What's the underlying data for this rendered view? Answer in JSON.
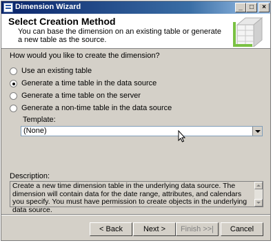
{
  "window": {
    "title": "Dimension Wizard",
    "controls": {
      "minimize": "_",
      "maximize": "□",
      "close": "×"
    }
  },
  "header": {
    "title": "Select Creation Method",
    "description": "You can base the dimension on an existing table or generate a new table as the source."
  },
  "question": "How would you like to create the dimension?",
  "options": [
    {
      "label": "Use an existing table",
      "checked": false
    },
    {
      "label": "Generate a time table in the data source",
      "checked": true
    },
    {
      "label": "Generate a time table on the server",
      "checked": false
    },
    {
      "label": "Generate a non-time table in the data source",
      "checked": false
    }
  ],
  "template": {
    "label": "Template:",
    "value": "(None)"
  },
  "description": {
    "label": "Description:",
    "text": "Create a new time dimension table in the underlying data source. The dimension will contain data for the date range, attributes, and calendars you specify. You must have permission to create objects in the underlying data source."
  },
  "buttons": {
    "back": "< Back",
    "next": "Next >",
    "finish": "Finish >>|",
    "cancel": "Cancel"
  },
  "colors": {
    "titlebar": "#0a246a",
    "dialog": "#d4d0c8",
    "accent_green": "#7ac143"
  }
}
